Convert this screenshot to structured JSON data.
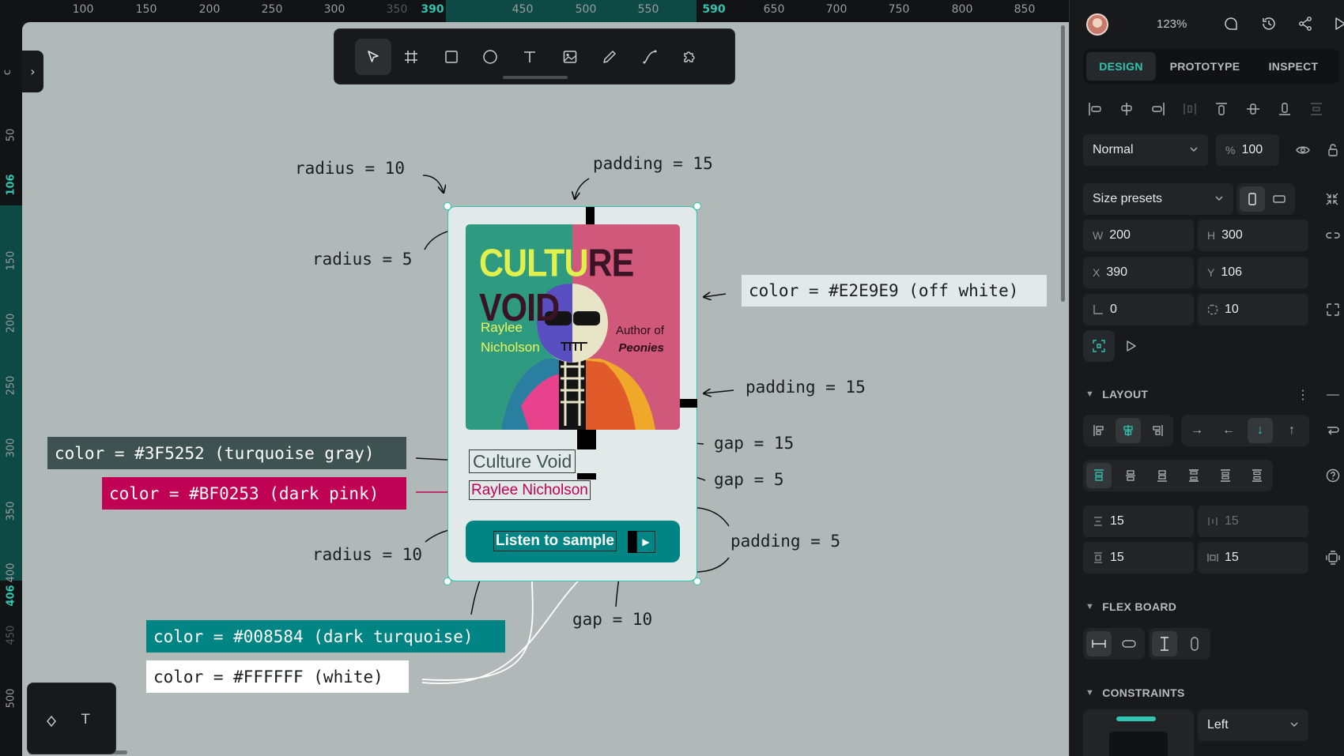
{
  "ruler": {
    "top_ticks": [
      "100",
      "150",
      "200",
      "250",
      "300",
      "350",
      "390",
      "450",
      "500",
      "550",
      "590",
      "650",
      "700",
      "750",
      "800",
      "850"
    ],
    "left_ticks": [
      "50",
      "106",
      "150",
      "200",
      "250",
      "300",
      "350",
      "400",
      "406",
      "450",
      "500"
    ]
  },
  "left_panel_label": "c",
  "toolbar": {
    "tools": [
      "select-icon",
      "board-icon",
      "rectangle-icon",
      "ellipse-icon",
      "text-icon",
      "image-icon",
      "pencil-icon",
      "path-icon",
      "plugins-icon"
    ],
    "active_tool": "select-icon"
  },
  "bottom_tools": [
    "shape-icon",
    "T"
  ],
  "annotations": {
    "radius_top": "radius = 10",
    "padding_top": "padding = 15",
    "radius_cover": "radius = 5",
    "color_card": "color = #E2E9E9 (off white)",
    "padding_right": "padding = 15",
    "gap_15": "gap = 15",
    "gap_5": "gap = 5",
    "color_title": "color = #3F5252 (turquoise gray)",
    "color_author": "color = #BF0253 (dark pink)",
    "radius_button": "radius = 10",
    "padding_button": "padding = 5",
    "gap_10": "gap = 10",
    "color_button": "color = #008584 (dark turquoise)",
    "color_white": "color = #FFFFFF (white)"
  },
  "card": {
    "cover_title_1": "CULTU",
    "cover_title_2": "RE VOID",
    "cover_author_1": "Raylee",
    "cover_author_2": "Nicholson",
    "cover_authorof_1": "Author of",
    "cover_authorof_2": "Peonies",
    "title": "Culture Void",
    "author": "Raylee Nicholson",
    "button_label": "Listen to sample"
  },
  "colors": {
    "card_bg": "#E2E9E9",
    "title": "#3F5252",
    "author": "#BF0253",
    "button": "#008584",
    "white": "#FFFFFF",
    "accent": "#31C4B1"
  },
  "panel": {
    "zoom": "123%",
    "tabs": [
      "DESIGN",
      "PROTOTYPE",
      "INSPECT"
    ],
    "active_tab": "DESIGN",
    "blend_mode": "Normal",
    "opacity_prefix": "%",
    "opacity": "100",
    "size_presets": "Size presets",
    "w_label": "W",
    "w": "200",
    "h_label": "H",
    "h": "300",
    "x_label": "X",
    "x": "390",
    "y_label": "Y",
    "y": "106",
    "rotation": "0",
    "radius": "10",
    "layout_title": "LAYOUT",
    "row_gap": "15",
    "col_gap": "15",
    "pad_v": "15",
    "pad_h": "15",
    "flex_board_title": "FLEX BOARD",
    "constraints_title": "CONSTRAINTS",
    "constraint_h": "Left"
  }
}
